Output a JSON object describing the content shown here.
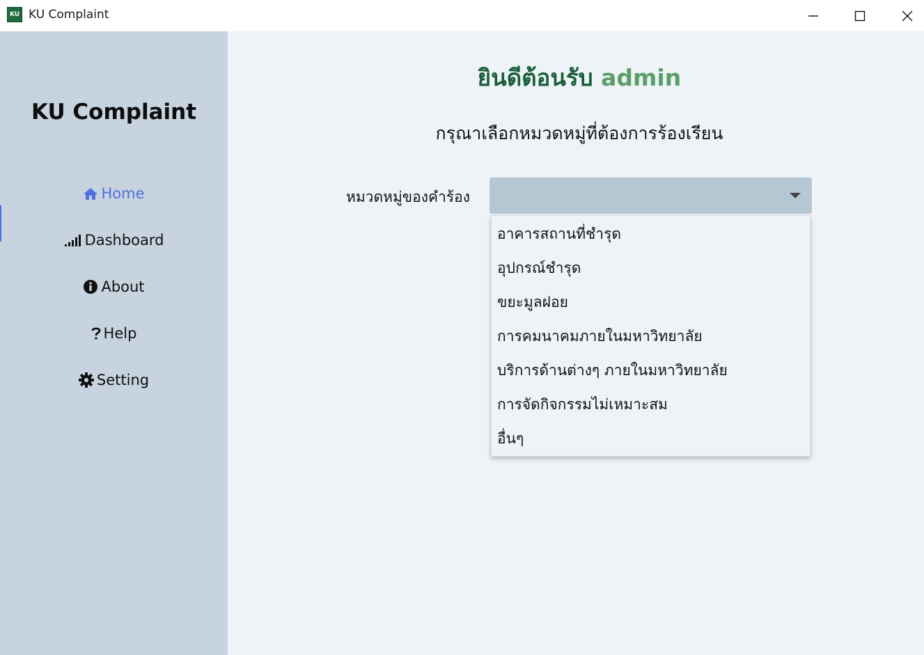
{
  "window": {
    "app_icon_text": "KU",
    "title": "KU Complaint",
    "icons": {
      "minimize": "minimize-icon",
      "maximize": "maximize-icon",
      "close": "close-icon"
    }
  },
  "sidebar": {
    "title": "KU Complaint",
    "items": [
      {
        "label": "Home",
        "icon": "home-icon",
        "active": true
      },
      {
        "label": "Dashboard",
        "icon": "signal-bars-icon",
        "active": false
      },
      {
        "label": "About",
        "icon": "info-icon",
        "active": false
      },
      {
        "label": "Help",
        "icon": "question-icon",
        "active": false
      },
      {
        "label": "Setting",
        "icon": "gear-icon",
        "active": false
      }
    ]
  },
  "main": {
    "welcome_text": "ยินดีต้อนรับ",
    "welcome_user": "admin",
    "subtitle": "กรุณาเลือกหมวดหมู่ที่ต้องการร้องเรียน",
    "category_label": "หมวดหมู่ของคำร้อง",
    "category_selected": "",
    "category_options": [
      "อาคารสถานที่ชำรุด",
      "อุปกรณ์ชำรุด",
      "ขยะมูลฝอย",
      "การคมนาคมภายในมหาวิทยาลัย",
      "บริการด้านต่างๆ ภายในมหาวิทยาลัย",
      "การจัดกิจกรรมไม่เหมาะสม",
      "อื่นๆ"
    ]
  },
  "colors": {
    "sidebar_bg": "#c7d3df",
    "main_bg": "#eef3f8",
    "active_nav": "#4e6fe0",
    "welcome_green": "#1a5e3a",
    "username_green": "#5c9e6a",
    "combo_bg": "#b6c7d4"
  }
}
